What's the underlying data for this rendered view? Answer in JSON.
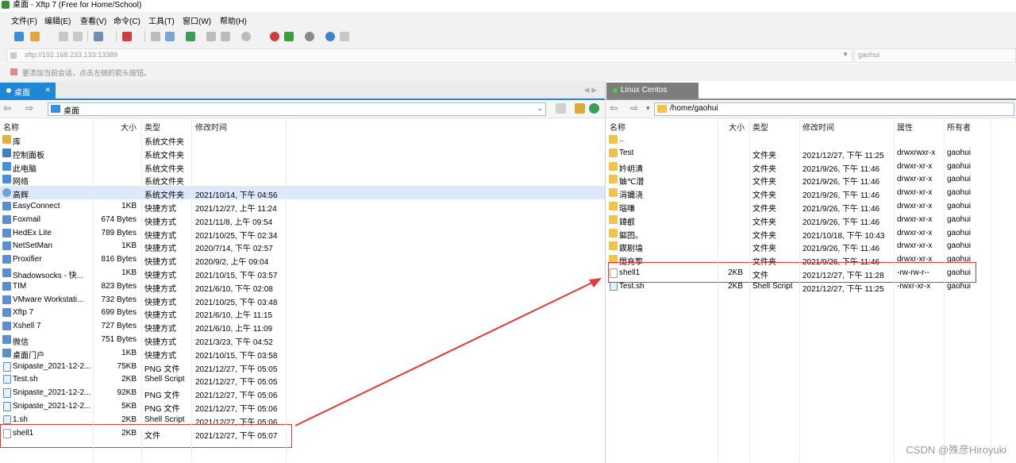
{
  "window": {
    "title": "桌面 - Xftp 7 (Free for Home/School)"
  },
  "menu": [
    "文件(F)",
    "编辑(E)",
    "查看(V)",
    "命令(C)",
    "工具(T)",
    "窗口(W)",
    "帮助(H)"
  ],
  "address": {
    "value": "sftp://192.168.233.133:13389",
    "user": "gaohui"
  },
  "hint": "要添加当前会话，点击左侧的箭头按钮。",
  "left": {
    "tab": "桌面",
    "path": "桌面",
    "columns": [
      "名称",
      "大小",
      "类型",
      "修改时间"
    ],
    "rows": [
      {
        "name": "库",
        "size": "",
        "type": "系统文件夹",
        "time": "",
        "icon": "library-icon"
      },
      {
        "name": "控制面板",
        "size": "",
        "type": "系统文件夹",
        "time": "",
        "icon": "control-panel-icon"
      },
      {
        "name": "此电脑",
        "size": "",
        "type": "系统文件夹",
        "time": "",
        "icon": "computer-icon"
      },
      {
        "name": "网络",
        "size": "",
        "type": "系统文件夹",
        "time": "",
        "icon": "network-icon"
      },
      {
        "name": "高辉",
        "size": "",
        "type": "系统文件夹",
        "time": "2021/10/14, 下午 04:56",
        "icon": "user-icon"
      },
      {
        "name": "EasyConnect",
        "size": "1KB",
        "type": "快捷方式",
        "time": "2021/12/27, 上午 11:24",
        "icon": "shortcut-icon"
      },
      {
        "name": "Foxmail",
        "size": "674 Bytes",
        "type": "快捷方式",
        "time": "2021/11/8, 上午 09:54",
        "icon": "shortcut-icon"
      },
      {
        "name": "HedEx Lite",
        "size": "789 Bytes",
        "type": "快捷方式",
        "time": "2021/10/25, 下午 02:34",
        "icon": "shortcut-icon"
      },
      {
        "name": "NetSetMan",
        "size": "1KB",
        "type": "快捷方式",
        "time": "2020/7/14, 下午 02:57",
        "icon": "shortcut-icon"
      },
      {
        "name": "Proxifier",
        "size": "816 Bytes",
        "type": "快捷方式",
        "time": "2020/9/2, 上午 09:04",
        "icon": "shortcut-icon"
      },
      {
        "name": "Shadowsocks - 快...",
        "size": "1KB",
        "type": "快捷方式",
        "time": "2021/10/15, 下午 03:57",
        "icon": "shortcut-icon"
      },
      {
        "name": "TIM",
        "size": "823 Bytes",
        "type": "快捷方式",
        "time": "2021/6/10, 下午 02:08",
        "icon": "shortcut-icon"
      },
      {
        "name": "VMware Workstati...",
        "size": "732 Bytes",
        "type": "快捷方式",
        "time": "2021/10/25, 下午 03:48",
        "icon": "shortcut-icon"
      },
      {
        "name": "Xftp 7",
        "size": "699 Bytes",
        "type": "快捷方式",
        "time": "2021/6/10, 上午 11:15",
        "icon": "shortcut-icon"
      },
      {
        "name": "Xshell 7",
        "size": "727 Bytes",
        "type": "快捷方式",
        "time": "2021/6/10, 上午 11:09",
        "icon": "shortcut-icon"
      },
      {
        "name": "微信",
        "size": "751 Bytes",
        "type": "快捷方式",
        "time": "2021/3/23, 下午 04:52",
        "icon": "shortcut-icon"
      },
      {
        "name": "桌面门户",
        "size": "1KB",
        "type": "快捷方式",
        "time": "2021/10/15, 下午 03:58",
        "icon": "shortcut-icon"
      },
      {
        "name": "Snipaste_2021-12-2...",
        "size": "75KB",
        "type": "PNG 文件",
        "time": "2021/12/27, 下午 05:05",
        "icon": "png-file-icon"
      },
      {
        "name": "Test.sh",
        "size": "2KB",
        "type": "Shell Script",
        "time": "2021/12/27, 下午 05:05",
        "icon": "shell-script-icon"
      },
      {
        "name": "Snipaste_2021-12-2...",
        "size": "92KB",
        "type": "PNG 文件",
        "time": "2021/12/27, 下午 05:06",
        "icon": "png-file-icon"
      },
      {
        "name": "Snipaste_2021-12-2...",
        "size": "5KB",
        "type": "PNG 文件",
        "time": "2021/12/27, 下午 05:06",
        "icon": "png-file-icon"
      },
      {
        "name": "1.sh",
        "size": "2KB",
        "type": "Shell Script",
        "time": "2021/12/27, 下午 05:06",
        "icon": "shell-script-icon"
      },
      {
        "name": "shell1",
        "size": "2KB",
        "type": "文件",
        "time": "2021/12/27, 下午 05:07",
        "icon": "file-icon"
      }
    ]
  },
  "right": {
    "tab": "Linux Centos",
    "path": "/home/gaohui",
    "columns": [
      "名称",
      "大小",
      "类型",
      "修改时间",
      "属性",
      "所有者"
    ],
    "rows": [
      {
        "name": "..",
        "size": "",
        "type": "",
        "time": "",
        "attr": "",
        "owner": "",
        "icon": "folder-icon"
      },
      {
        "name": "Test",
        "size": "",
        "type": "文件夹",
        "time": "2021/12/27, 下午 11:25",
        "attr": "drwxrwxr-x",
        "owner": "gaohui",
        "icon": "folder-icon"
      },
      {
        "name": "妗岄潰",
        "size": "",
        "type": "文件夹",
        "time": "2021/9/26, 下午 11:46",
        "attr": "drwxr-xr-x",
        "owner": "gaohui",
        "icon": "folder-icon"
      },
      {
        "name": "妯℃澘",
        "size": "",
        "type": "文件夹",
        "time": "2021/9/26, 下午 11:46",
        "attr": "drwxr-xr-x",
        "owner": "gaohui",
        "icon": "folder-icon"
      },
      {
        "name": "涓嬭浇",
        "size": "",
        "type": "文件夹",
        "time": "2021/9/26, 下午 11:46",
        "attr": "drwxr-xr-x",
        "owner": "gaohui",
        "icon": "folder-icon"
      },
      {
        "name": "瑙嗛",
        "size": "",
        "type": "文件夹",
        "time": "2021/9/26, 下午 11:46",
        "attr": "drwxr-xr-x",
        "owner": "gaohui",
        "icon": "folder-icon"
      },
      {
        "name": "鍏叡",
        "size": "",
        "type": "文件夹",
        "time": "2021/9/26, 下午 11:46",
        "attr": "drwxr-xr-x",
        "owner": "gaohui",
        "icon": "folder-icon"
      },
      {
        "name": "鏂囨。",
        "size": "",
        "type": "文件夹",
        "time": "2021/10/18, 下午 10:43",
        "attr": "drwxr-xr-x",
        "owner": "gaohui",
        "icon": "folder-icon"
      },
      {
        "name": "鍥剧墖",
        "size": "",
        "type": "文件夹",
        "time": "2021/9/26, 下午 11:46",
        "attr": "drwxr-xr-x",
        "owner": "gaohui",
        "icon": "folder-icon"
      },
      {
        "name": "闊充箰",
        "size": "",
        "type": "文件夹",
        "time": "2021/9/26, 下午 11:46",
        "attr": "drwxr-xr-x",
        "owner": "gaohui",
        "icon": "folder-icon"
      },
      {
        "name": "shell1",
        "size": "2KB",
        "type": "文件",
        "time": "2021/12/27, 下午 11:28",
        "attr": "-rw-rw-r--",
        "owner": "gaohui",
        "icon": "file-icon"
      },
      {
        "name": "Test.sh",
        "size": "2KB",
        "type": "Shell Script",
        "time": "2021/12/27, 下午 11:25",
        "attr": "-rwxr-xr-x",
        "owner": "gaohui",
        "icon": "shell-script-icon"
      }
    ]
  },
  "watermark": "CSDN @殊彦Hiroyuki",
  "colors": {
    "accent": "#1e88d8",
    "highlight": "#e53935",
    "selection": "#dbe9f8"
  }
}
